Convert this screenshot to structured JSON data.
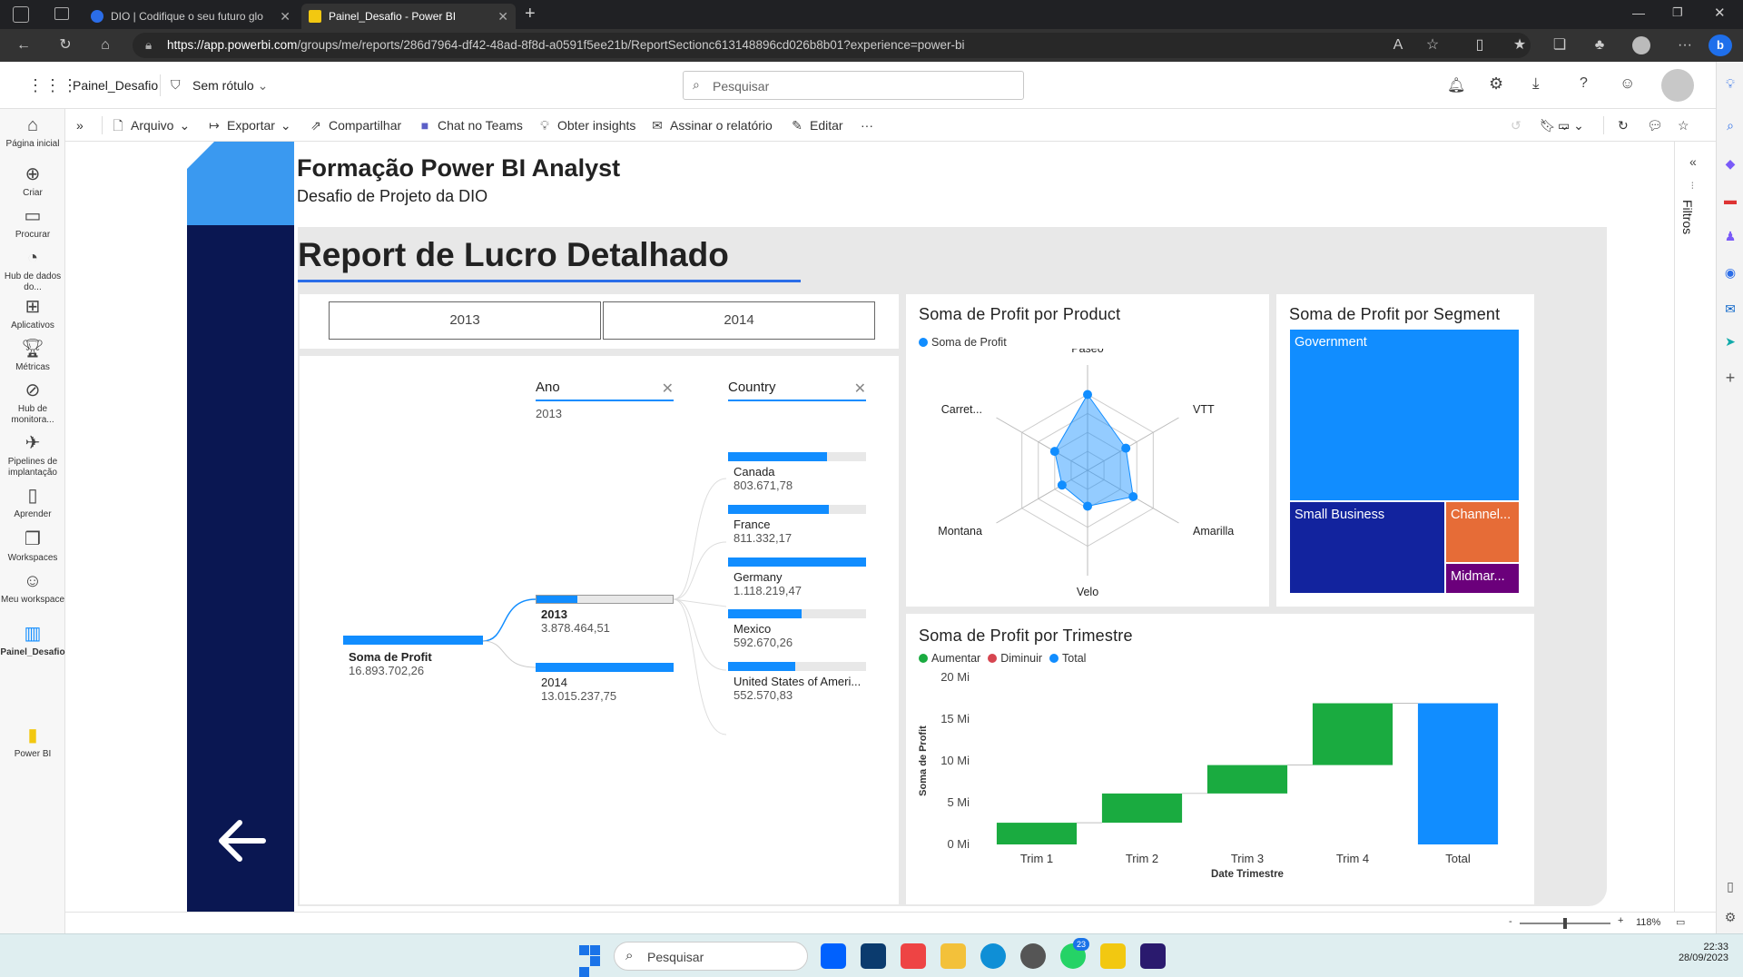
{
  "browser": {
    "tabs": [
      {
        "title": "DIO | Codifique o seu futuro glo"
      },
      {
        "title": "Painel_Desafio - Power BI"
      }
    ],
    "url_host": "https://app.powerbi.com",
    "url_path": "/groups/me/reports/286d7964-df42-48ad-8f8d-a0591f5ee21b/ReportSectionc613148896cd026b8b01?experience=power-bi"
  },
  "header": {
    "report_name": "Painel_Desafio",
    "sensitivity": "Sem rótulo",
    "search_placeholder": "Pesquisar"
  },
  "toolbar": {
    "arquivo": "Arquivo",
    "exportar": "Exportar",
    "compartilhar": "Compartilhar",
    "chat": "Chat no Teams",
    "insights": "Obter insights",
    "assinar": "Assinar o relatório",
    "editar": "Editar",
    "more": "···"
  },
  "nav": [
    {
      "label": "Página inicial",
      "icon": "home-icon"
    },
    {
      "label": "Criar",
      "icon": "plus-circle-icon"
    },
    {
      "label": "Procurar",
      "icon": "folder-icon"
    },
    {
      "label": "Hub de dados do...",
      "icon": "data-hub-icon"
    },
    {
      "label": "Aplicativos",
      "icon": "apps-icon"
    },
    {
      "label": "Métricas",
      "icon": "trophy-icon"
    },
    {
      "label": "Hub de monitora...",
      "icon": "monitor-icon"
    },
    {
      "label": "Pipelines de implantação",
      "icon": "rocket-icon"
    },
    {
      "label": "Aprender",
      "icon": "book-icon"
    },
    {
      "label": "Workspaces",
      "icon": "workspaces-icon"
    },
    {
      "label": "Meu workspace",
      "icon": "person-icon"
    },
    {
      "label": "Painel_Desafio",
      "icon": "report-icon"
    },
    {
      "label": "Power BI",
      "icon": "powerbi-logo-icon"
    }
  ],
  "report": {
    "title": "Formação Power BI Analyst",
    "subtitle": "Desafio de Projeto da DIO",
    "heading": "Report de Lucro Detalhado",
    "slicer": [
      "2013",
      "2014"
    ],
    "filters_label": "Filtros",
    "zoom": "118%"
  },
  "decomp": {
    "col1": "Ano",
    "col1_sel": "2013",
    "col2": "Country",
    "root": {
      "name": "Soma de Profit",
      "value": "16.893.702,26"
    },
    "years": [
      {
        "name": "2013",
        "value": "3.878.464,51",
        "fill": 0.3
      },
      {
        "name": "2014",
        "value": "13.015.237,75",
        "fill": 1.0
      }
    ],
    "countries": [
      {
        "name": "Canada",
        "value": "803.671,78",
        "fill": 0.72
      },
      {
        "name": "France",
        "value": "811.332,17",
        "fill": 0.73
      },
      {
        "name": "Germany",
        "value": "1.118.219,47",
        "fill": 1.0
      },
      {
        "name": "Mexico",
        "value": "592.670,26",
        "fill": 0.53
      },
      {
        "name": "United States of Ameri...",
        "value": "552.570,83",
        "fill": 0.49
      }
    ]
  },
  "radar": {
    "title": "Soma de Profit por Product",
    "legend": "Soma de Profit",
    "color": "#118dff",
    "axes": [
      "Paseo",
      "VTT",
      "Amarilla",
      "Velo",
      "Montana",
      "Carret..."
    ],
    "values": [
      0.72,
      0.42,
      0.5,
      0.34,
      0.28,
      0.36
    ]
  },
  "treemap": {
    "title": "Soma de Profit por Segment",
    "items": [
      {
        "name": "Government",
        "color": "#118dff"
      },
      {
        "name": "Small Business",
        "color": "#12239e"
      },
      {
        "name": "Channel...",
        "color": "#e66c37"
      },
      {
        "name": "Midmar...",
        "color": "#6b007b"
      }
    ]
  },
  "chart_data": {
    "type": "bar",
    "subtype": "waterfall",
    "title": "Soma de Profit por Trimestre",
    "xlabel": "Date Trimestre",
    "ylabel": "Soma de Profit",
    "legend": [
      {
        "name": "Aumentar",
        "color": "#1aab40"
      },
      {
        "name": "Diminuir",
        "color": "#d64550"
      },
      {
        "name": "Total",
        "color": "#118dff"
      }
    ],
    "categories": [
      "Trim 1",
      "Trim 2",
      "Trim 3",
      "Trim 4",
      "Total"
    ],
    "values": [
      2.6,
      3.5,
      3.4,
      7.4,
      16.9
    ],
    "ylim": [
      0,
      20
    ],
    "yticks": [
      "0 Mi",
      "5 Mi",
      "10 Mi",
      "15 Mi",
      "20 Mi"
    ]
  },
  "status": {
    "minus": "-",
    "plus": "+"
  },
  "taskbar": {
    "search": "Pesquisar",
    "time": "22:33",
    "date": "28/09/2023",
    "badge": "23"
  }
}
